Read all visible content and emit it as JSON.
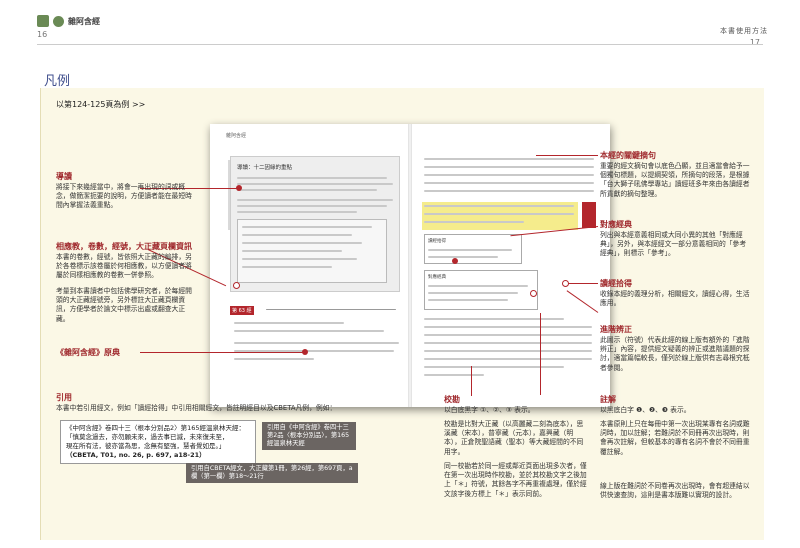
{
  "header": {
    "left_title": "雜阿含經",
    "left_page": "16",
    "right_title": "本書使用方法",
    "right_page": "17"
  },
  "section_title": "凡例",
  "example_link": "以第124-125頁為例 >>",
  "annotations": {
    "daodu": {
      "label": "導讀",
      "text": "將接下來幾經當中，將會一再出現的詞或概念，做簡潔扼要的說明，方便讀者能在最短時間內掌握法義重點。"
    },
    "xiangdu": {
      "label": "相應教，卷數，經號，大正藏頁欄資訊",
      "text": "本書的卷數，經號，皆依照大正藏的編排，另於各卷標示該卷屬於何相應教，以方便讀者將屬於同樣相應教的卷數一併參照。",
      "text2": "考量到本書讀者中包括佛學研究者，於每經開頭的大正藏經號旁，另外標註大正藏頁欄資訊，方便學者於論文中標示出處或翻查大正藏。"
    },
    "yuandian": {
      "label": "《雜阿含經》原典"
    },
    "guanjian": {
      "label": "本經的關鍵摘句",
      "text": "重要的經文摘句會以底色凸顯，並且適當會給予一個獨句標題，以提綱契領，所摘句的段落，是根據「台大獅子吼佛學專站」讀經班多年來由各讀經者所貢獻的摘句整理。"
    },
    "duiying": {
      "label": "對應經典",
      "text": "列出與本經意義相同或大同小異的其他「對應經典」，另外，與本經經文一部分意義相同的「參考經典」，則標示「參考」。"
    },
    "duzheng": {
      "label": "讀經拾得",
      "text": "收錄本經的義理分析，相關經文，讀經心得，生活應用。"
    },
    "jinjie": {
      "label": "進階辨正",
      "text": "此圖示（符號）代表此經的線上版有額外的「進階辨正」內容，提供經文疑義的辨正或進階議題的探討，適當篇幅較長，僅列於線上版供有志尋根究柢者參閱。"
    },
    "zhushi": {
      "label": "註解",
      "text1": "以黑底白字 ❶、❷、❸ 表示。",
      "text2": "本書原則上只在每冊中第一次出現某專有名詞或難詞時，加以註解；若難詞於不同冊再次出現時，則會再次註解，但較基本的專有名詞不會於不同冊重覆註解。",
      "text3": "線上版在難詞於不同卷再次出現時，會有超連結以供快速查詢，這則是書本版難以實現的設計。"
    },
    "jiaokan": {
      "label": "校勘",
      "text1": "以白底黑字 ①、②、③ 表示。",
      "text2": "校勘是比對大正藏（以高麗藏二刻為底本），思溪藏（宋本），普寧藏（元本），嘉興藏（明本），正倉院聖語藏（聖本）等大藏經間的不同用字。",
      "text3": "同一校勘若於同一經或鄰近頁面出現多次者，僅在第一次出現時作校勘，並於其校勘文字之後加上「＊」符號，其餘各字不再重複處理，僅於經文該字後方標上「＊」表示同前。"
    },
    "yinyong": {
      "label": "引用",
      "text": "本書中若引用經文，例如「讀經拾得」中引用相關經文，皆註明經目以及CBETA凡例，例如："
    }
  },
  "citation": {
    "line1": "《中阿含經》卷四十三〈根本分別品2〉第165經溫泉林天經：",
    "line2": "「慎莫念過去，亦勿願未來，過去事已滅，未來復未至，",
    "line3": "現在所有法，彼亦當為思，念無有堅強，慧者覺如是。」",
    "line4": "（CBETA, T01, no. 26, p. 697, a18-21）"
  },
  "tags": {
    "tag1": "引用自《中阿含經》卷四十三第2品〈根本分別品〉，第165經溫泉林天經",
    "tag2": "引用自CBETA經文，大正藏第1冊，第26經，第697頁，a欄（第一欄）第18～21行"
  },
  "book_page": {
    "left_header": "雜阿含經",
    "guide_title": "導讀：十二因緣的重點",
    "sutra_no": "第 63 經",
    "right_title": "讀經拾得",
    "dui_title": "對應經典"
  }
}
